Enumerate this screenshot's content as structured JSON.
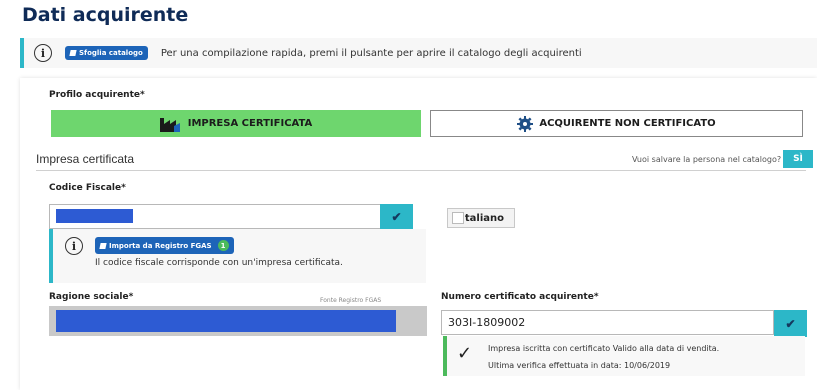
{
  "page_title": "Dati acquirente",
  "info_bar": {
    "icon": "info-icon",
    "button_label": "Sfoglia catalogo",
    "text": "Per una compilazione rapida, premi il pulsante per aprire il catalogo degli acquirenti"
  },
  "profile": {
    "label": "Profilo acquirente*",
    "option_certified": "IMPRESA CERTIFICATA",
    "option_non_certified": "ACQUIRENTE NON CERTIFICATO",
    "selected": "IMPRESA CERTIFICATA"
  },
  "section": {
    "title": "Impresa certificata",
    "save_question": "Vuoi salvare la persona nel catalogo?",
    "save_toggle": "SÌ"
  },
  "codice_fiscale": {
    "label": "Codice Fiscale*",
    "value": "",
    "language_button": "Italiano",
    "fgas_button": "Importa da Registro FGAS",
    "fgas_badge": "1",
    "fgas_message": "Il codice fiscale corrisponde con un'impresa certificata."
  },
  "ragione_sociale": {
    "label": "Ragione sociale*",
    "source_note": "Fonte Registro FGAS",
    "value": ""
  },
  "numero_certificato": {
    "label": "Numero certificato acquirente*",
    "value": "303I-1809002",
    "validation_line1": "Impresa iscritta con certificato Valido alla data di vendita.",
    "validation_line2": "Ultima verifica effettuata in data: 10/06/2019"
  },
  "colors": {
    "title": "#0f2b57",
    "accent_teal": "#2cb7c8",
    "selected_green": "#6ed66e",
    "valid_green": "#4cba5c",
    "button_blue": "#1d64b8",
    "redacted_blue": "#2d5bd3"
  }
}
